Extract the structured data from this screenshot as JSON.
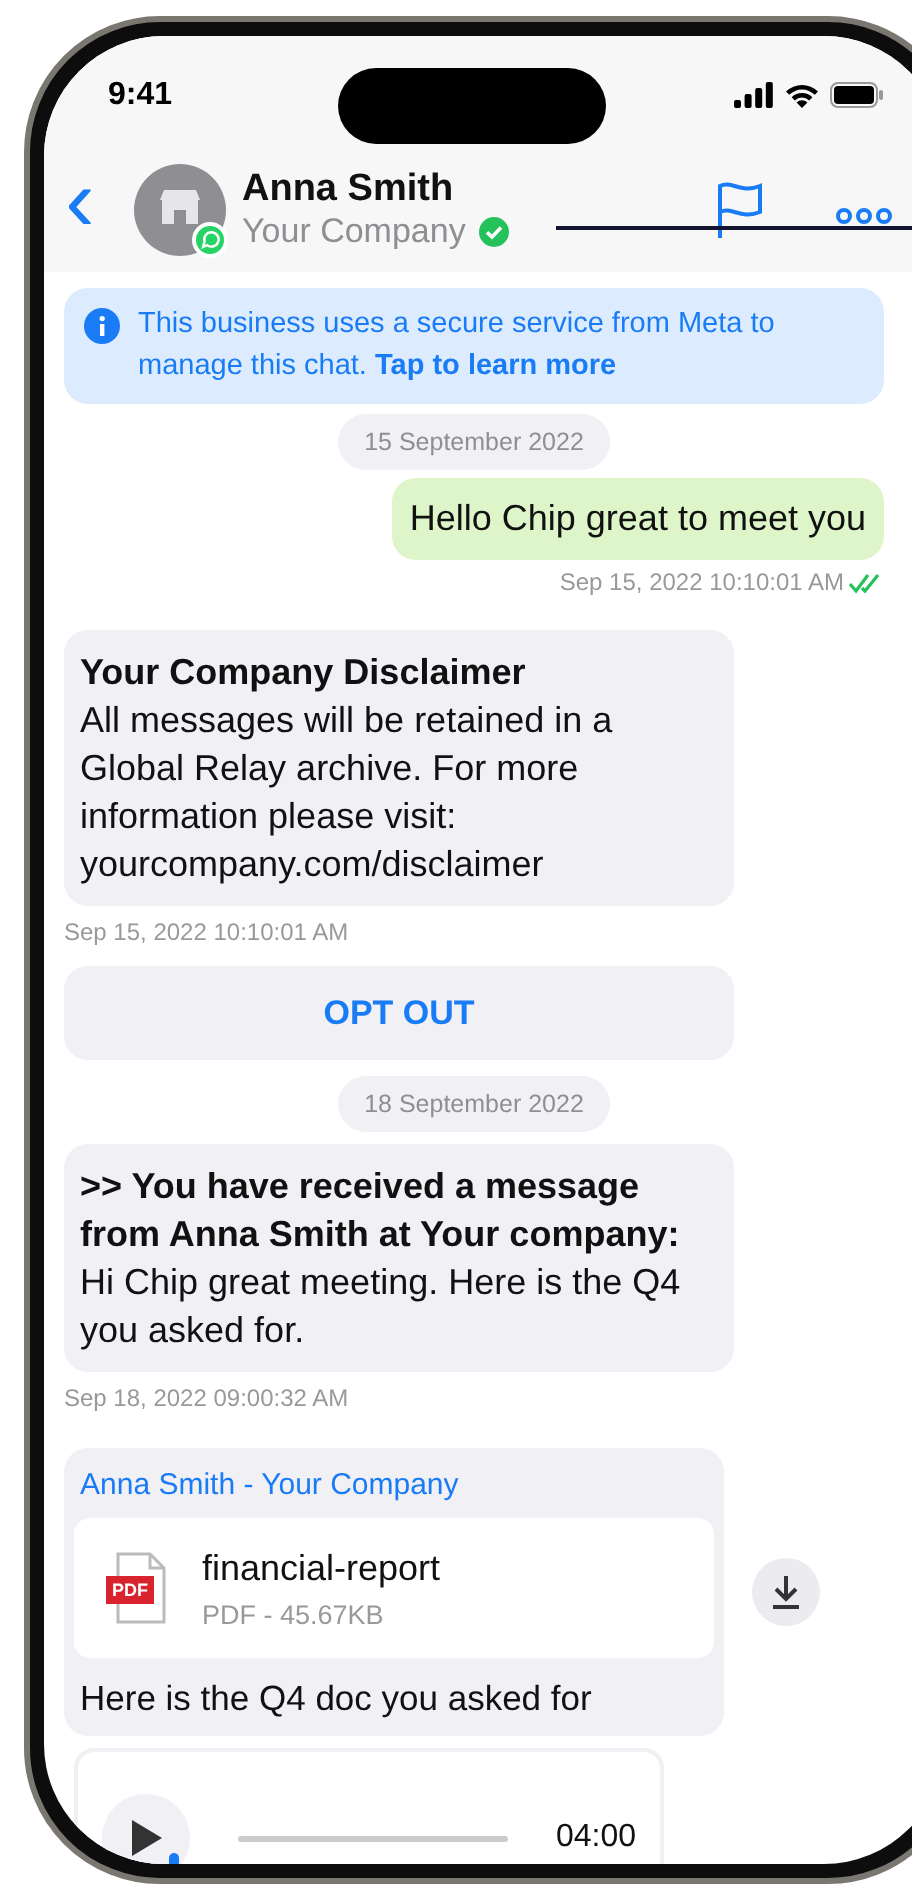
{
  "status_bar": {
    "time": "9:41"
  },
  "header": {
    "back": "‹",
    "name": "Anna Smith",
    "company": "Your Company"
  },
  "banner": {
    "text": "This business uses a secure service from Meta to manage this chat. **Tap to learn more**"
  },
  "messages": [
    {
      "kind": "date",
      "text": "15 September 2022"
    },
    {
      "kind": "outgoing",
      "text": "Hello Chip great to meet you",
      "time": "Sep 15, 2022 10:10:01 AM",
      "read": true
    },
    {
      "kind": "incoming",
      "title": "Your Company Disclaimer",
      "text": "All messages will be retained in a Global Relay archive. For more information please visit: yourcompany.com/disclaimer",
      "time": "Sep 15, 2022 10:10:01 AM"
    },
    {
      "kind": "button",
      "text": "OPT OUT"
    },
    {
      "kind": "date",
      "text": "18 September 2022"
    },
    {
      "kind": "incoming",
      "title": ">> You have received a message from Anna Smith at Your company:",
      "text": "Hi Chip great meeting. Here is the Q4 you asked for.",
      "time": "Sep 18, 2022 09:00:32 AM"
    },
    {
      "kind": "file",
      "sender": "Anna Smith - Your Company",
      "file_badge": "PDF",
      "file_name": "financial-report",
      "file_info": "PDF - 45.67KB",
      "caption": "Here is the Q4 doc you asked for"
    },
    {
      "kind": "audio",
      "duration": "04:00"
    }
  ]
}
